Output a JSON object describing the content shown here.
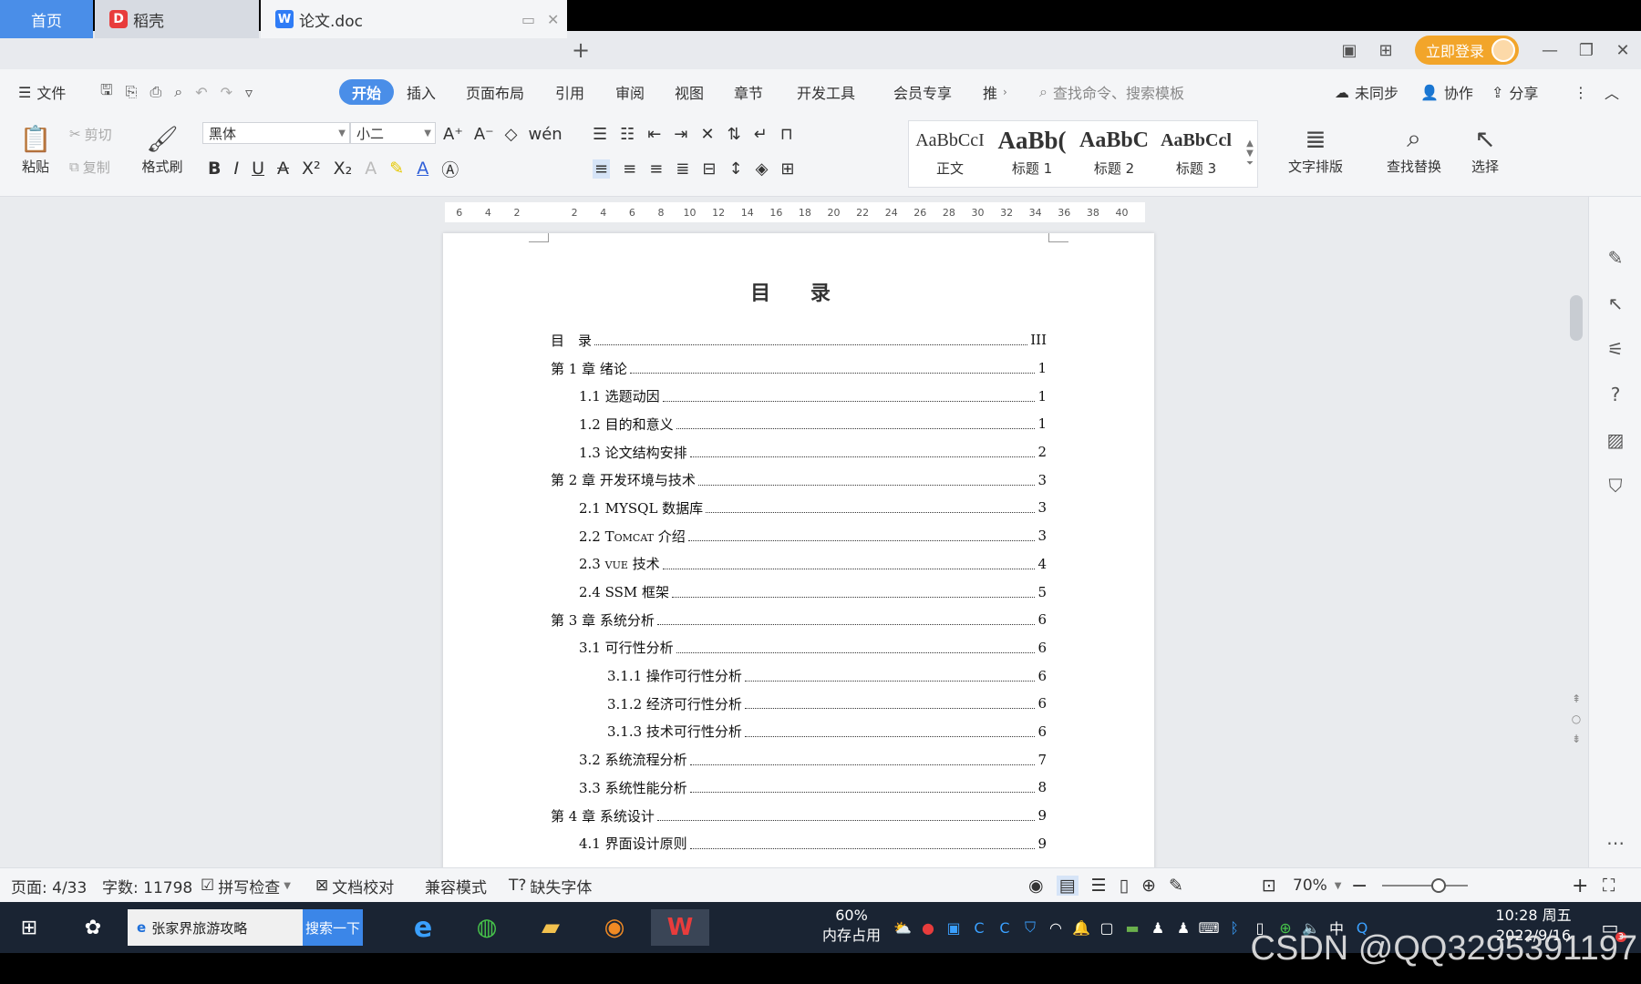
{
  "tabs": {
    "home": "首页",
    "daoke": "稻壳",
    "doc": "论文.doc",
    "login": "立即登录"
  },
  "menu": {
    "file": "文件",
    "items": [
      "开始",
      "插入",
      "页面布局",
      "引用",
      "审阅",
      "视图",
      "章节",
      "开发工具",
      "会员专享",
      "推"
    ],
    "search_placeholder": "查找命令、搜索模板",
    "sync": "未同步",
    "collab": "协作",
    "share": "分享"
  },
  "ribbon": {
    "paste": "粘贴",
    "cut": "剪切",
    "copy": "复制",
    "format_painter": "格式刷",
    "font_name": "黑体",
    "font_size": "小二",
    "styles": [
      {
        "sample": "AaBbCcI",
        "label": "正文"
      },
      {
        "sample": "AaBb(",
        "label": "标题 1"
      },
      {
        "sample": "AaBbC",
        "label": "标题 2"
      },
      {
        "sample": "AaBbCcl",
        "label": "标题 3"
      }
    ],
    "text_layout": "文字排版",
    "find_replace": "查找替换",
    "select": "选择"
  },
  "ruler": [
    "6",
    "4",
    "2",
    "",
    "2",
    "4",
    "6",
    "8",
    "10",
    "12",
    "14",
    "16",
    "18",
    "20",
    "22",
    "24",
    "26",
    "28",
    "30",
    "32",
    "34",
    "36",
    "38",
    "40"
  ],
  "document": {
    "title": "目 录",
    "toc": [
      {
        "level": 1,
        "text": "目　录",
        "page": "III"
      },
      {
        "level": 1,
        "text": "第 1 章  绪论",
        "page": "1"
      },
      {
        "level": 2,
        "text": "1.1 选题动因",
        "page": "1"
      },
      {
        "level": 2,
        "text": "1.2 目的和意义",
        "page": "1"
      },
      {
        "level": 2,
        "text": "1.3 论文结构安排",
        "page": "2"
      },
      {
        "level": 1,
        "text": "第 2 章  开发环境与技术",
        "page": "3"
      },
      {
        "level": 2,
        "text": "2.1 MYSQL 数据库",
        "page": "3"
      },
      {
        "level": 2,
        "text": "2.2 Tomcat 介绍",
        "page": "3"
      },
      {
        "level": 2,
        "text": "2.3 vue 技术",
        "page": "4"
      },
      {
        "level": 2,
        "text": "2.4 SSM 框架",
        "page": "5"
      },
      {
        "level": 1,
        "text": "第 3 章  系统分析",
        "page": "6"
      },
      {
        "level": 2,
        "text": "3.1 可行性分析",
        "page": "6"
      },
      {
        "level": 3,
        "text": "3.1.1 操作可行性分析",
        "page": "6"
      },
      {
        "level": 3,
        "text": "3.1.2 经济可行性分析",
        "page": "6"
      },
      {
        "level": 3,
        "text": "3.1.3 技术可行性分析",
        "page": "6"
      },
      {
        "level": 2,
        "text": "3.2 系统流程分析",
        "page": "7"
      },
      {
        "level": 2,
        "text": "3.3 系统性能分析",
        "page": "8"
      },
      {
        "level": 1,
        "text": "第 4 章  系统设计",
        "page": "9"
      },
      {
        "level": 2,
        "text": "4.1 界面设计原则",
        "page": "9"
      }
    ]
  },
  "status": {
    "page": "页面: 4/33",
    "words": "字数: 11798",
    "spell": "拼写检查",
    "proof": "文档校对",
    "compat": "兼容模式",
    "missing_font": "缺失字体",
    "zoom": "70%"
  },
  "taskbar": {
    "search_text": "张家界旅游攻略",
    "search_button": "搜索一下",
    "mem_percent": "60%",
    "mem_label": "内存占用",
    "ime": "中",
    "time": "10:28 周五",
    "date": "2022/9/16",
    "notif_count": "3"
  },
  "watermark": "CSDN @QQ3295391197",
  "colors": {
    "accent": "#4a8ee8",
    "login": "#f2a52a",
    "taskbar": "#1a2433"
  }
}
